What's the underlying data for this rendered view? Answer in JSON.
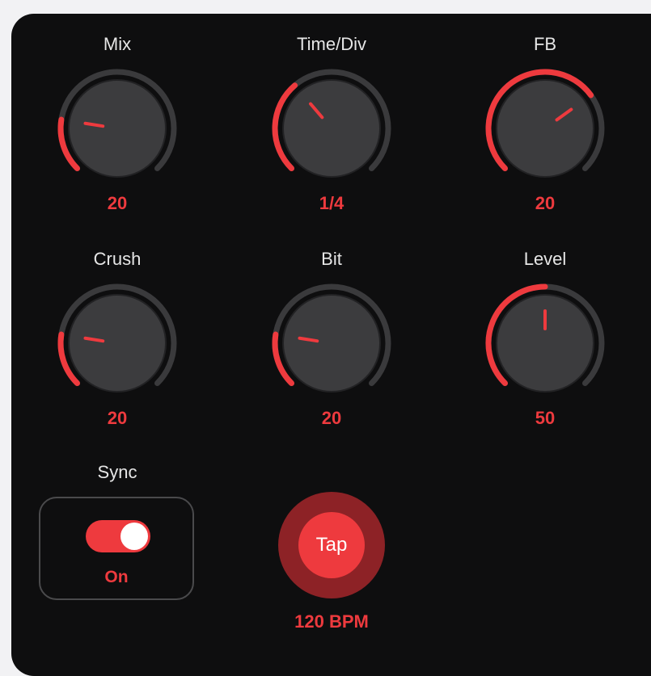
{
  "knobs": [
    {
      "id": "mix",
      "label": "Mix",
      "value_text": "20",
      "level": 0.2
    },
    {
      "id": "time-div",
      "label": "Time/Div",
      "value_text": "1/4",
      "level": 0.35
    },
    {
      "id": "fb",
      "label": "FB",
      "value_text": "20",
      "level": 0.7
    },
    {
      "id": "crush",
      "label": "Crush",
      "value_text": "20",
      "level": 0.2
    },
    {
      "id": "bit",
      "label": "Bit",
      "value_text": "20",
      "level": 0.2
    },
    {
      "id": "level",
      "label": "Level",
      "value_text": "50",
      "level": 0.5
    }
  ],
  "sync": {
    "label": "Sync",
    "state": "On",
    "enabled": true
  },
  "tap": {
    "label": "Tap",
    "bpm": "120 BPM"
  },
  "colors": {
    "accent": "#ee3a3e",
    "track": "#3a3a3c",
    "knob_body": "#3c3c3e",
    "panel": "#0e0e0f"
  }
}
